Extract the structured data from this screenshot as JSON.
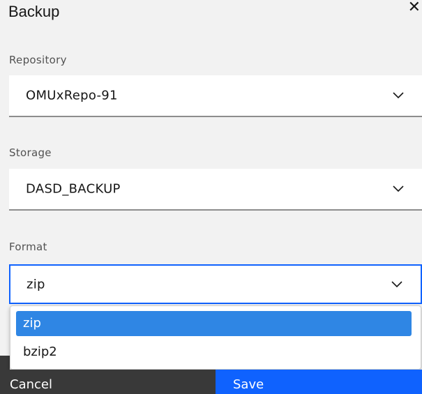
{
  "dialog": {
    "title": "Backup",
    "close_icon": "close-icon"
  },
  "repository": {
    "label": "Repository",
    "value": "OMUxRepo-91"
  },
  "storage": {
    "label": "Storage",
    "value": "DASD_BACKUP"
  },
  "format": {
    "label": "Format",
    "value": "zip",
    "options": [
      "zip",
      "bzip2"
    ],
    "selected_option": "zip"
  },
  "footer": {
    "cancel_label": "Cancel",
    "save_label": "Save"
  },
  "colors": {
    "primary": "#0f62fe",
    "secondary": "#393939",
    "highlight": "#2f86e4"
  }
}
